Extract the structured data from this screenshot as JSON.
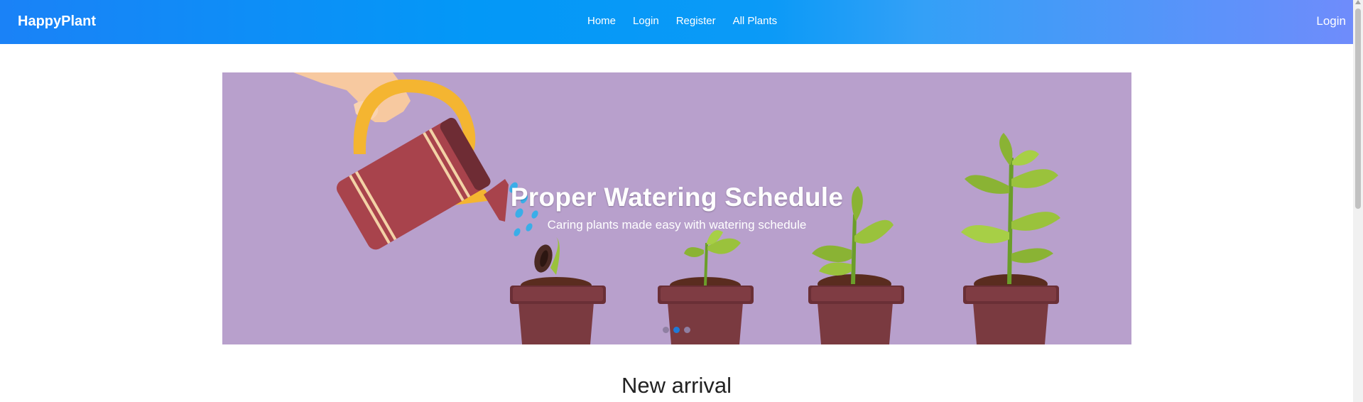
{
  "navbar": {
    "brand": "HappyPlant",
    "links": [
      "Home",
      "Login",
      "Register",
      "All Plants"
    ],
    "right_link": "Login"
  },
  "carousel": {
    "title": "Proper Watering Schedule",
    "subtitle": "Caring plants made easy with watering schedule",
    "slide_count": 3,
    "active_slide": 2
  },
  "section": {
    "title": "New arrival"
  },
  "colors": {
    "banner_background": "#b8a0cc",
    "indicator_active": "#1e7ad8"
  }
}
